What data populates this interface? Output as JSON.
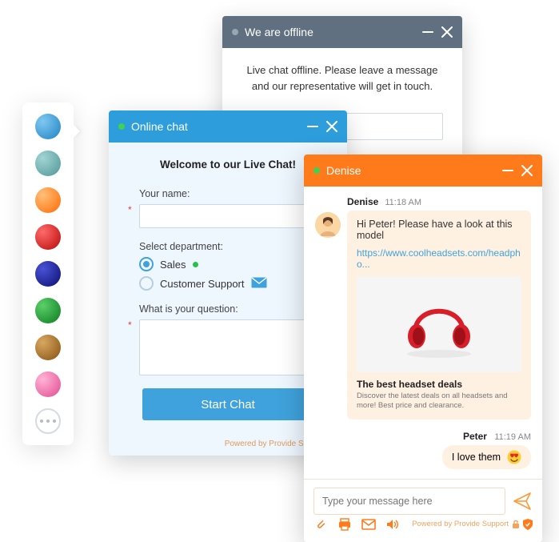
{
  "palette": {
    "colors": [
      "#3fa2dc",
      "#6fb8b8",
      "#ff8a2a",
      "#e8262a",
      "#1a1f9a",
      "#1fa33a",
      "#b47a2a",
      "#f06aa8"
    ]
  },
  "offline": {
    "title": "We are offline",
    "status_color": "#9aa7b3",
    "message": "Live chat offline. Please leave a message and our representative will get in touch."
  },
  "online": {
    "title": "Online chat",
    "status_color": "#3ed152",
    "welcome": "Welcome to our Live Chat!",
    "name_label": "Your name:",
    "dept_label": "Select department:",
    "dept_options": {
      "sales": "Sales",
      "support": "Customer Support"
    },
    "question_label": "What is your question:",
    "start_label": "Start Chat",
    "powered": "Powered by Provide Support"
  },
  "agent": {
    "title": "Denise",
    "status_color": "#3ed152",
    "message": {
      "author": "Denise",
      "time": "11:18 AM",
      "text": "Hi Peter! Please have a look at this model",
      "link": "https://www.coolheadsets.com/headpho...",
      "preview_title": "The best headset deals",
      "preview_desc": "Discover the latest deals on all headsets and more! Best price and clearance."
    },
    "reply": {
      "author": "Peter",
      "time": "11:19 AM",
      "text": "I love them"
    },
    "compose_placeholder": "Type your message here",
    "powered": "Powered by Provide Support"
  }
}
